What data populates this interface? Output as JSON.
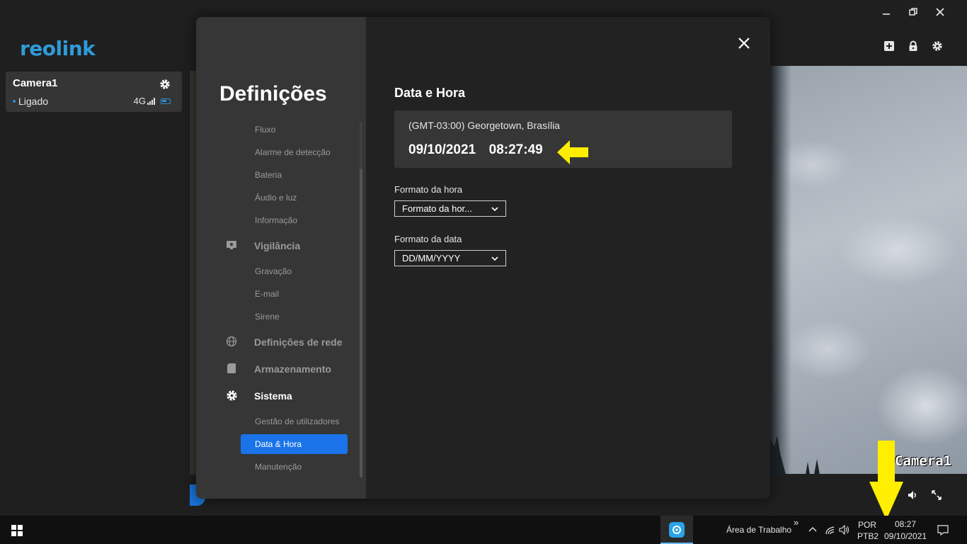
{
  "app": {
    "logo": "reolink",
    "camera": {
      "name": "Camera1",
      "status": "Ligado",
      "signal": "4G"
    },
    "camera_overlay_label": "Camera1"
  },
  "settings": {
    "title": "Definições",
    "nav": {
      "fluxo": "Fluxo",
      "alarme": "Alarme de detecção",
      "bateria": "Bateria",
      "audio": "Áudio e luz",
      "informacao": "Informação",
      "vigilancia": "Vigilância",
      "gravacao": "Gravação",
      "email": "E-mail",
      "sirene": "Sirene",
      "rede": "Definições de rede",
      "armazenamento": "Armazenamento",
      "sistema": "Sistema",
      "utilizadores": "Gestão de utilizadores",
      "data_hora": "Data & Hora",
      "manutencao": "Manutenção"
    },
    "content": {
      "title": "Data e Hora",
      "timezone": "(GMT-03:00) Georgetown, Brasília",
      "datetime": "09/10/2021  08:27:49",
      "time_format_label": "Formato da hora",
      "time_format_value": "Formato da hor...",
      "date_format_label": "Formato da data",
      "date_format_value": "DD/MM/YYYY"
    }
  },
  "taskbar": {
    "desktop": "Área de Trabalho",
    "overflow": "»",
    "lang_top": "POR",
    "lang_bottom": "PTB2",
    "clock_time": "08:27",
    "clock_date": "09/10/2021"
  },
  "colors": {
    "accent": "#1a73e8",
    "arrow": "#ffee00",
    "logo": "#2f9bd8"
  }
}
